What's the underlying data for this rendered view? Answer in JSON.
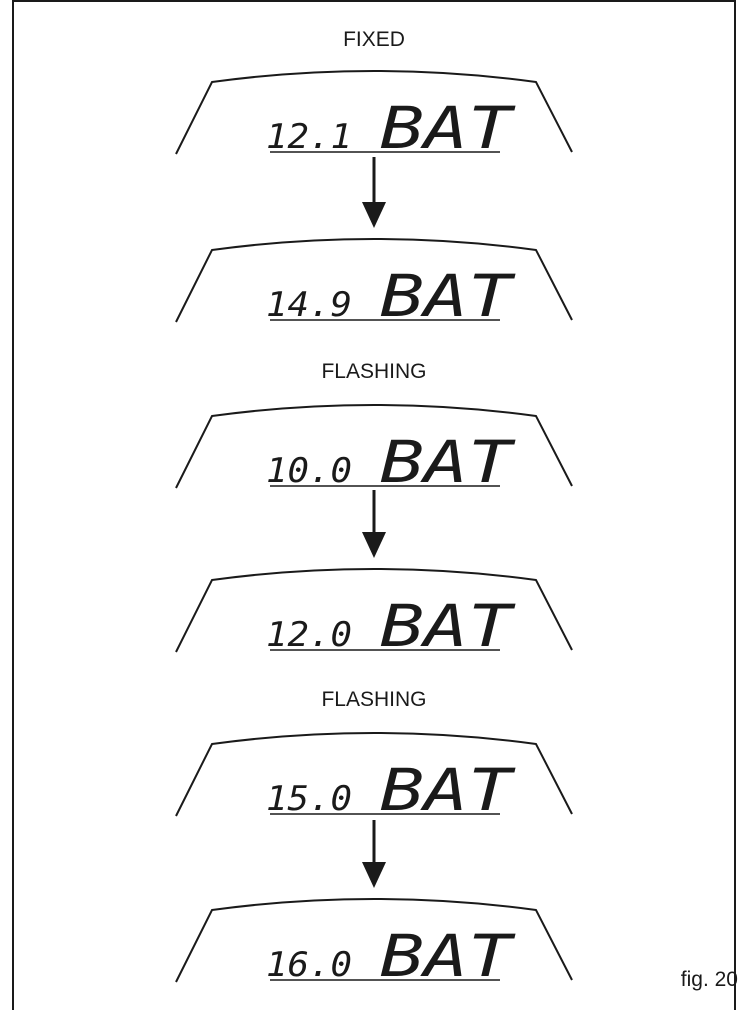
{
  "states": [
    {
      "label": "FIXED",
      "displays": [
        {
          "value": "12.1",
          "text": "BAT"
        },
        {
          "value": "14.9",
          "text": "BAT"
        }
      ]
    },
    {
      "label": "FLASHING",
      "displays": [
        {
          "value": "10.0",
          "text": "BAT"
        },
        {
          "value": "12.0",
          "text": "BAT"
        }
      ]
    },
    {
      "label": "FLASHING",
      "displays": [
        {
          "value": "15.0",
          "text": "BAT"
        },
        {
          "value": "16.0",
          "text": "BAT"
        }
      ]
    }
  ],
  "figure_label": "fig. 20",
  "colors": {
    "line": "#1a1a1a",
    "background": "#ffffff"
  }
}
